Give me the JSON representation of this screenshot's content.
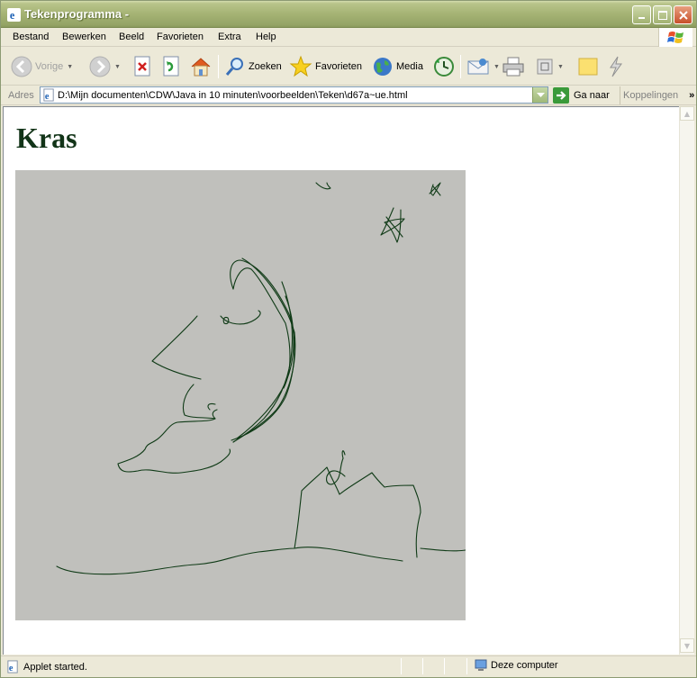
{
  "window": {
    "title": "Tekenprogramma -"
  },
  "menu": [
    "Bestand",
    "Bewerken",
    "Beeld",
    "Favorieten",
    "Extra",
    "Help"
  ],
  "toolbar": {
    "back_label": "Vorige",
    "search_label": "Zoeken",
    "favorites_label": "Favorieten",
    "media_label": "Media"
  },
  "address": {
    "label": "Adres",
    "value": "D:\\Mijn documenten\\CDW\\Java in 10 minuten\\voorbeelden\\Teken\\d67a~ue.html",
    "go_label": "Ga naar",
    "links_label": "Koppelingen"
  },
  "page": {
    "heading": "Kras"
  },
  "applet": {
    "background": "#c0c0bc",
    "stroke": "#0f3a16"
  },
  "status": {
    "text": "Applet started.",
    "zone": "Deze computer"
  },
  "colors": {
    "titlebar": "#a5b374",
    "heading": "#123418"
  }
}
